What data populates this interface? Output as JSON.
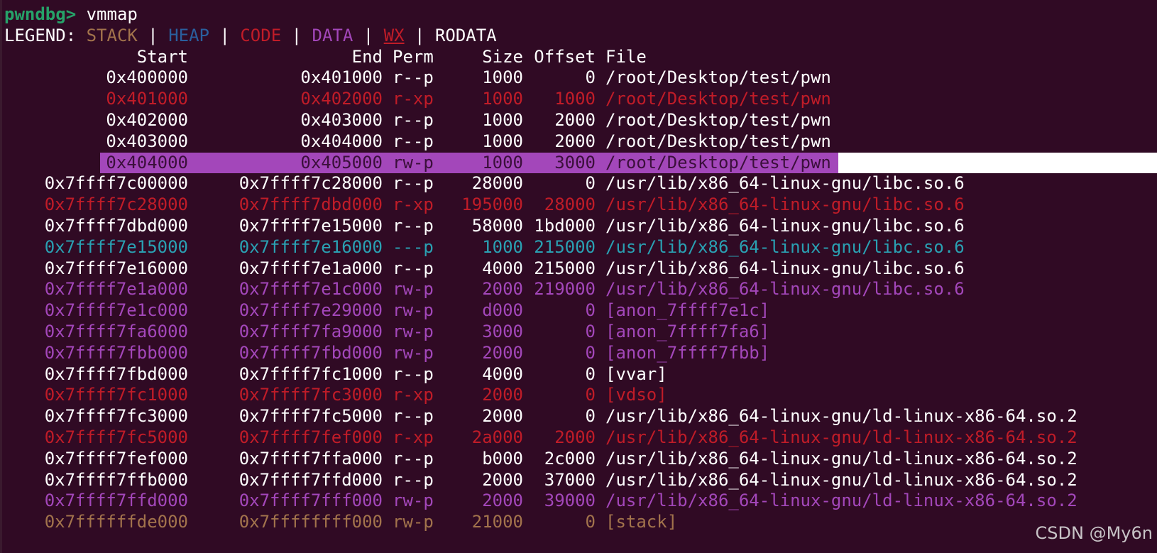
{
  "prompt": {
    "text": "pwndbg> ",
    "command": "vmmap"
  },
  "legend": {
    "label": "LEGEND: ",
    "sep": " | ",
    "items": [
      {
        "text": "STACK",
        "color": "#a2734c"
      },
      {
        "text": "HEAP",
        "color": "#2a5f9e"
      },
      {
        "text": "CODE",
        "color": "#c01c28"
      },
      {
        "text": "DATA",
        "color": "#a347ba"
      },
      {
        "text": "WX",
        "color": "#c01c28"
      },
      {
        "text": "RODATA",
        "color": "#ffffff"
      }
    ]
  },
  "headers": {
    "start": "Start",
    "end": "End",
    "perm": "Perm",
    "size": "Size",
    "offset": "Offset",
    "file": "File"
  },
  "colors": {
    "rodata": "#ffffff",
    "code": "#c01c28",
    "data": "#a347ba",
    "stack": "#a2734c",
    "none": "#2aa1b3",
    "highlight_bg": "#a347ba",
    "highlight_fg": "#3b0f3b",
    "background": "#300a24"
  },
  "rows": [
    {
      "start": "0x400000",
      "end": "0x401000",
      "perm": "r--p",
      "size": "1000",
      "offset": "0",
      "file": "/root/Desktop/test/pwn",
      "kind": "rodata"
    },
    {
      "start": "0x401000",
      "end": "0x402000",
      "perm": "r-xp",
      "size": "1000",
      "offset": "1000",
      "file": "/root/Desktop/test/pwn",
      "kind": "code"
    },
    {
      "start": "0x402000",
      "end": "0x403000",
      "perm": "r--p",
      "size": "1000",
      "offset": "2000",
      "file": "/root/Desktop/test/pwn",
      "kind": "rodata"
    },
    {
      "start": "0x403000",
      "end": "0x404000",
      "perm": "r--p",
      "size": "1000",
      "offset": "2000",
      "file": "/root/Desktop/test/pwn",
      "kind": "rodata"
    },
    {
      "start": "0x404000",
      "end": "0x405000",
      "perm": "rw-p",
      "size": "1000",
      "offset": "3000",
      "file": "/root/Desktop/test/pwn",
      "kind": "highlight"
    },
    {
      "start": "0x7ffff7c00000",
      "end": "0x7ffff7c28000",
      "perm": "r--p",
      "size": "28000",
      "offset": "0",
      "file": "/usr/lib/x86_64-linux-gnu/libc.so.6",
      "kind": "rodata"
    },
    {
      "start": "0x7ffff7c28000",
      "end": "0x7ffff7dbd000",
      "perm": "r-xp",
      "size": "195000",
      "offset": "28000",
      "file": "/usr/lib/x86_64-linux-gnu/libc.so.6",
      "kind": "code"
    },
    {
      "start": "0x7ffff7dbd000",
      "end": "0x7ffff7e15000",
      "perm": "r--p",
      "size": "58000",
      "offset": "1bd000",
      "file": "/usr/lib/x86_64-linux-gnu/libc.so.6",
      "kind": "rodata"
    },
    {
      "start": "0x7ffff7e15000",
      "end": "0x7ffff7e16000",
      "perm": "---p",
      "size": "1000",
      "offset": "215000",
      "file": "/usr/lib/x86_64-linux-gnu/libc.so.6",
      "kind": "none"
    },
    {
      "start": "0x7ffff7e16000",
      "end": "0x7ffff7e1a000",
      "perm": "r--p",
      "size": "4000",
      "offset": "215000",
      "file": "/usr/lib/x86_64-linux-gnu/libc.so.6",
      "kind": "rodata"
    },
    {
      "start": "0x7ffff7e1a000",
      "end": "0x7ffff7e1c000",
      "perm": "rw-p",
      "size": "2000",
      "offset": "219000",
      "file": "/usr/lib/x86_64-linux-gnu/libc.so.6",
      "kind": "data"
    },
    {
      "start": "0x7ffff7e1c000",
      "end": "0x7ffff7e29000",
      "perm": "rw-p",
      "size": "d000",
      "offset": "0",
      "file": "[anon_7ffff7e1c]",
      "kind": "data"
    },
    {
      "start": "0x7ffff7fa6000",
      "end": "0x7ffff7fa9000",
      "perm": "rw-p",
      "size": "3000",
      "offset": "0",
      "file": "[anon_7ffff7fa6]",
      "kind": "data"
    },
    {
      "start": "0x7ffff7fbb000",
      "end": "0x7ffff7fbd000",
      "perm": "rw-p",
      "size": "2000",
      "offset": "0",
      "file": "[anon_7ffff7fbb]",
      "kind": "data"
    },
    {
      "start": "0x7ffff7fbd000",
      "end": "0x7ffff7fc1000",
      "perm": "r--p",
      "size": "4000",
      "offset": "0",
      "file": "[vvar]",
      "kind": "rodata"
    },
    {
      "start": "0x7ffff7fc1000",
      "end": "0x7ffff7fc3000",
      "perm": "r-xp",
      "size": "2000",
      "offset": "0",
      "file": "[vdso]",
      "kind": "code"
    },
    {
      "start": "0x7ffff7fc3000",
      "end": "0x7ffff7fc5000",
      "perm": "r--p",
      "size": "2000",
      "offset": "0",
      "file": "/usr/lib/x86_64-linux-gnu/ld-linux-x86-64.so.2",
      "kind": "rodata"
    },
    {
      "start": "0x7ffff7fc5000",
      "end": "0x7ffff7fef000",
      "perm": "r-xp",
      "size": "2a000",
      "offset": "2000",
      "file": "/usr/lib/x86_64-linux-gnu/ld-linux-x86-64.so.2",
      "kind": "code"
    },
    {
      "start": "0x7ffff7fef000",
      "end": "0x7ffff7ffa000",
      "perm": "r--p",
      "size": "b000",
      "offset": "2c000",
      "file": "/usr/lib/x86_64-linux-gnu/ld-linux-x86-64.so.2",
      "kind": "rodata"
    },
    {
      "start": "0x7ffff7ffb000",
      "end": "0x7ffff7ffd000",
      "perm": "r--p",
      "size": "2000",
      "offset": "37000",
      "file": "/usr/lib/x86_64-linux-gnu/ld-linux-x86-64.so.2",
      "kind": "rodata"
    },
    {
      "start": "0x7ffff7ffd000",
      "end": "0x7ffff7fff000",
      "perm": "rw-p",
      "size": "2000",
      "offset": "39000",
      "file": "/usr/lib/x86_64-linux-gnu/ld-linux-x86-64.so.2",
      "kind": "data"
    },
    {
      "start": "0x7ffffffde000",
      "end": "0x7ffffffff000",
      "perm": "rw-p",
      "size": "21000",
      "offset": "0",
      "file": "[stack]",
      "kind": "stack"
    }
  ],
  "watermark": "CSDN @My6n"
}
